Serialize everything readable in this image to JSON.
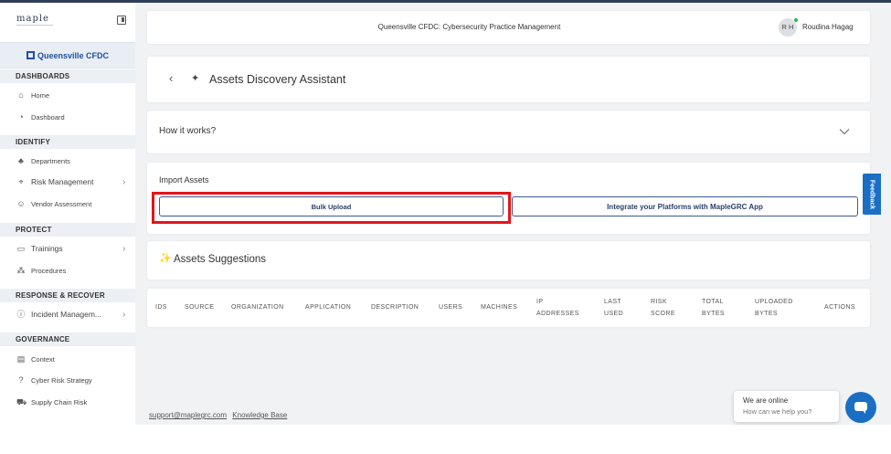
{
  "sidebar": {
    "logo": "maple",
    "org": "Queensville CFDC",
    "sections": {
      "dashboards": "DASHBOARDS",
      "identify": "IDENTIFY",
      "protect": "PROTECT",
      "response": "RESPONSE & RECOVER",
      "governance": "GOVERNANCE"
    },
    "items": {
      "home": "Home",
      "dashboard": "Dashboard",
      "departments": "Departments",
      "risk_management": "Risk Management",
      "vendor_assessment": "Vendor Assessment",
      "trainings": "Trainings",
      "procedures": "Procedures",
      "incident_management": "Incident Managem...",
      "context": "Context",
      "cyber_risk_strategy": "Cyber Risk Strategy",
      "supply_chain_risk": "Supply Chain Risk"
    }
  },
  "header": {
    "title": "Queensville CFDC: Cybersecurity Practice Management",
    "avatar_initials": "R H",
    "user_name": "Roudina Hagag"
  },
  "page": {
    "title": "Assets Discovery Assistant",
    "how_it_works": "How it works?",
    "import_label": "Import Assets",
    "bulk_upload": "Bulk Upload",
    "integrate": "Integrate your Platforms with MapleGRC App",
    "suggestions_title": "Assets Suggestions"
  },
  "table": {
    "columns": [
      "IDS",
      "SOURCE",
      "ORGANIZATION",
      "APPLICATION",
      "DESCRIPTION",
      "USERS",
      "MACHINES",
      "IP ADDRESSES",
      "LAST USED",
      "RISK SCORE",
      "TOTAL BYTES",
      "UPLOADED BYTES",
      "ACTIONS"
    ]
  },
  "footer": {
    "email": "support@maplegrc.com",
    "kb": "Knowledge Base"
  },
  "feedback": "Feedback",
  "chat": {
    "status": "We are online",
    "prompt": "How can we help you?"
  },
  "colors": {
    "accent": "#1a6fc4",
    "highlight": "#e3151a",
    "online": "#29b34a"
  }
}
